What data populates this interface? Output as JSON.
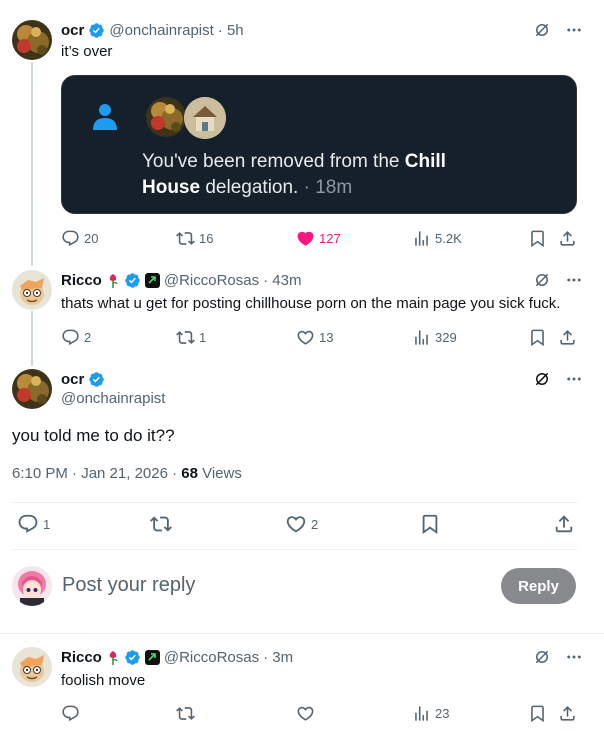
{
  "post1": {
    "name": "ocr",
    "handle": "@onchainrapist",
    "time": "· 5h",
    "text": "it’s over",
    "card": {
      "text_prefix": "You've been removed from the ",
      "text_bold1": "Chill",
      "text_bold2": "House",
      "text_suffix": " delegation.",
      "time": " · 18m"
    },
    "actions": {
      "replies": "20",
      "reposts": "16",
      "likes": "127",
      "views": "5.2K"
    }
  },
  "post2": {
    "name": "Ricco",
    "handle": "@RiccoRosas",
    "time": "· 43m",
    "text": "thats what u get for posting chillhouse porn on the main page you sick fuck.",
    "actions": {
      "replies": "2",
      "reposts": "1",
      "likes": "13",
      "views": "329"
    }
  },
  "main": {
    "name": "ocr",
    "handle": "@onchainrapist",
    "text": "you told me to do it??",
    "timestamp": "6:10 PM · Jan 21, 2026 · ",
    "views_count": "68",
    "views_label": " Views",
    "actions": {
      "replies": "1",
      "likes": "2"
    }
  },
  "compose": {
    "placeholder": "Post your reply",
    "button": "Reply"
  },
  "post3": {
    "name": "Ricco",
    "handle": "@RiccoRosas",
    "time": "· 3m",
    "text": "foolish move",
    "actions": {
      "views": "23"
    }
  },
  "colors": {
    "accent": "#1d9bf0",
    "like": "#f91880",
    "muted": "#536471",
    "card_bg": "#15202b"
  }
}
